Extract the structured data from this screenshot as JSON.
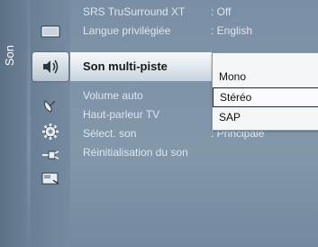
{
  "side_tab": {
    "label": "Son"
  },
  "icons": [
    {
      "name": "picture-icon"
    },
    {
      "name": "sound-icon",
      "active": true
    },
    {
      "name": "satellite-dish-icon"
    },
    {
      "name": "settings-gear-icon"
    },
    {
      "name": "input-plug-icon"
    },
    {
      "name": "application-icon"
    }
  ],
  "menu": {
    "items": [
      {
        "label": "SRS TruSurround XT",
        "value": ": Off"
      },
      {
        "label": "Langue privilégiée",
        "value": ": English"
      },
      {
        "label": "Son multi-piste",
        "value": ":"
      },
      {
        "label": "Volume auto",
        "value": ":"
      },
      {
        "label": "Haut-parleur TV",
        "value": ":"
      },
      {
        "label": "Sélect. son",
        "value": ": Principale"
      },
      {
        "label": "Réinitialisation du son",
        "value": ""
      }
    ]
  },
  "popup": {
    "options": [
      {
        "label": "Mono"
      },
      {
        "label": "Stéréo",
        "focused": true
      },
      {
        "label": "SAP"
      }
    ]
  },
  "colors": {
    "background": "#7a8fa3",
    "highlight": "#e6edf3",
    "text_light": "#dfe6ee",
    "text_dark": "#1a1a1a"
  }
}
